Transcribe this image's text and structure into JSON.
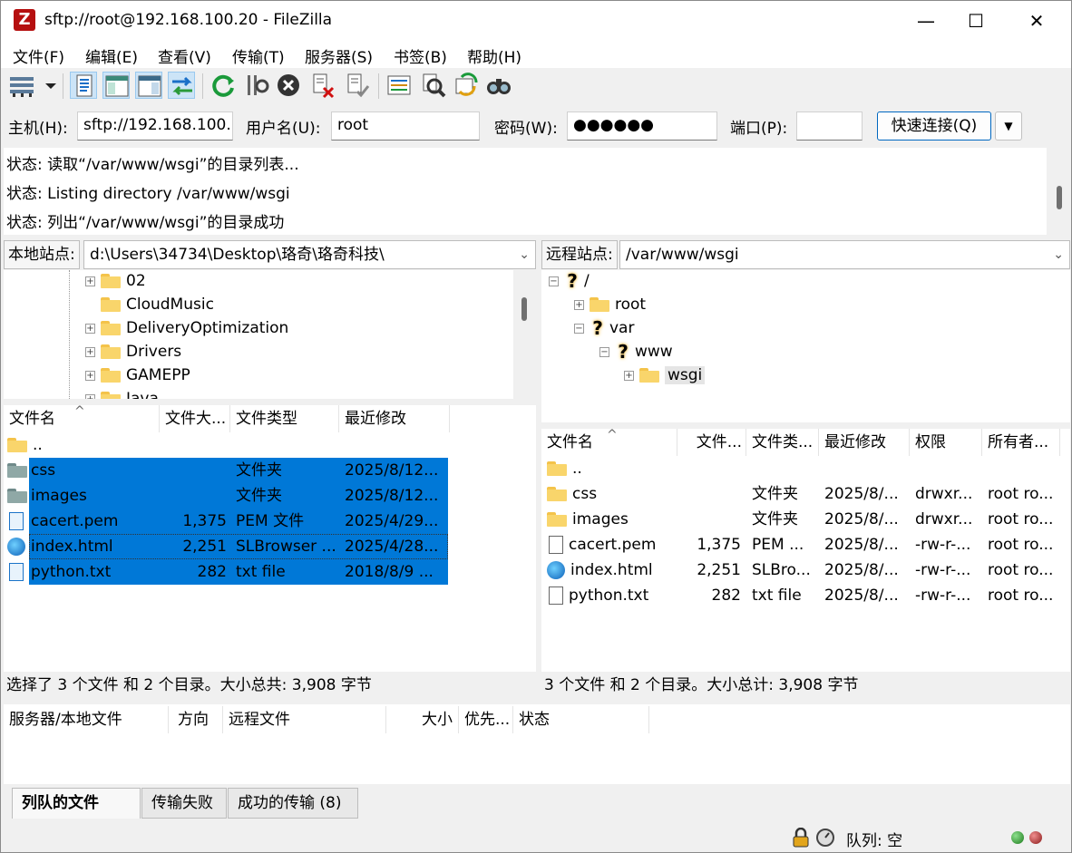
{
  "window": {
    "title": "sftp://root@192.168.100.20 - FileZilla",
    "app_logo": "Z",
    "minimize_glyph": "—",
    "maximize_glyph": "☐",
    "close_glyph": "✕"
  },
  "menu": [
    "文件(F)",
    "编辑(E)",
    "查看(V)",
    "传输(T)",
    "服务器(S)",
    "书签(B)",
    "帮助(H)"
  ],
  "toolbar_icons": [
    "site-manager-icon",
    "dropdown-arrow-icon",
    "toggle-log-icon",
    "toggle-local-tree-icon",
    "toggle-remote-tree-icon",
    "toggle-transfer-queue-icon",
    "refresh-icon",
    "process-queue-icon",
    "cancel-icon",
    "disconnect-icon",
    "reconnect-icon",
    "directory-compare-icon",
    "filter-icon",
    "sync-browse-icon",
    "search-icon"
  ],
  "quickconnect": {
    "host_label": "主机(H):",
    "host_value": "sftp://192.168.100.",
    "user_label": "用户名(U):",
    "user_value": "root",
    "pass_label": "密码(W):",
    "pass_value": "●●●●●●",
    "port_label": "端口(P):",
    "port_value": "",
    "connect_label": "快速连接(Q)",
    "dropdown_glyph": "▼"
  },
  "log": [
    "状态: 读取“/var/www/wsgi”的目录列表...",
    "状态: Listing directory /var/www/wsgi",
    "状态: 列出“/var/www/wsgi”的目录成功"
  ],
  "local": {
    "site_label": "本地站点:",
    "path": "d:\\Users\\34734\\Desktop\\珞奇\\珞奇科技\\",
    "tree": [
      "02",
      "CloudMusic",
      "DeliveryOptimization",
      "Drivers",
      "GAMEPP",
      "Java"
    ],
    "headers": [
      "文件名",
      "文件大...",
      "文件类型",
      "最近修改"
    ],
    "files": [
      {
        "name": "..",
        "size": "",
        "type": "",
        "modified": ""
      },
      {
        "name": "css",
        "size": "",
        "type": "文件夹",
        "modified": "2025/8/12..."
      },
      {
        "name": "images",
        "size": "",
        "type": "文件夹",
        "modified": "2025/8/12..."
      },
      {
        "name": "cacert.pem",
        "size": "1,375",
        "type": "PEM 文件",
        "modified": "2025/4/29..."
      },
      {
        "name": "index.html",
        "size": "2,251",
        "type": "SLBrowser ...",
        "modified": "2025/4/28..."
      },
      {
        "name": "python.txt",
        "size": "282",
        "type": "txt file",
        "modified": "2018/8/9 ..."
      }
    ],
    "status": "选择了 3 个文件 和 2 个目录。大小总共: 3,908 字节"
  },
  "remote": {
    "site_label": "远程站点:",
    "path": "/var/www/wsgi",
    "tree": [
      "/",
      "root",
      "var",
      "www",
      "wsgi"
    ],
    "headers": [
      "文件名",
      "文件...",
      "文件类...",
      "最近修改",
      "权限",
      "所有者..."
    ],
    "files": [
      {
        "name": "..",
        "size": "",
        "type": "",
        "modified": "",
        "perm": "",
        "owner": ""
      },
      {
        "name": "css",
        "size": "",
        "type": "文件夹",
        "modified": "2025/8/...",
        "perm": "drwxr...",
        "owner": "root ro..."
      },
      {
        "name": "images",
        "size": "",
        "type": "文件夹",
        "modified": "2025/8/...",
        "perm": "drwxr...",
        "owner": "root ro..."
      },
      {
        "name": "cacert.pem",
        "size": "1,375",
        "type": "PEM ...",
        "modified": "2025/8/...",
        "perm": "-rw-r-...",
        "owner": "root ro..."
      },
      {
        "name": "index.html",
        "size": "2,251",
        "type": "SLBro...",
        "modified": "2025/8/...",
        "perm": "-rw-r-...",
        "owner": "root ro..."
      },
      {
        "name": "python.txt",
        "size": "282",
        "type": "txt file",
        "modified": "2025/8/...",
        "perm": "-rw-r-...",
        "owner": "root ro..."
      }
    ],
    "status": "3 个文件 和 2 个目录。大小总计: 3,908 字节"
  },
  "queue": {
    "headers": [
      "服务器/本地文件",
      "方向",
      "远程文件",
      "大小",
      "优先...",
      "状态"
    ],
    "tabs": [
      "列队的文件",
      "传输失败",
      "成功的传输 (8)"
    ]
  },
  "statusbar": {
    "queue_text": "队列: 空"
  },
  "colors": {
    "selection": "#0078d7",
    "folder": "#f9d56b",
    "accent": "#0067c0"
  }
}
